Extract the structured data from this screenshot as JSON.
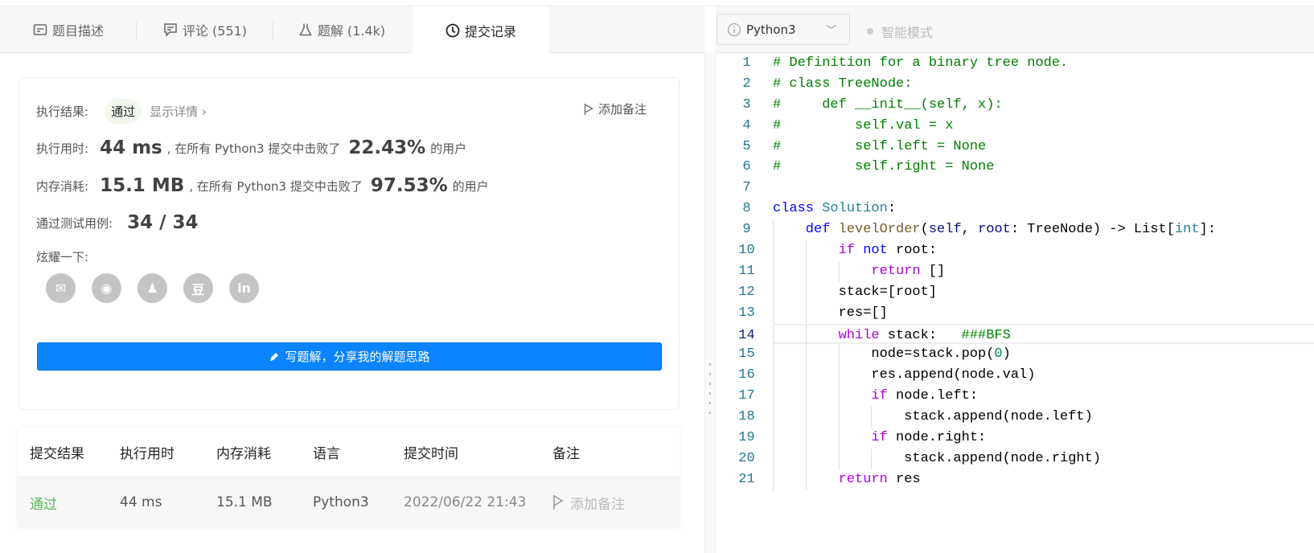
{
  "tabs": [
    {
      "label": "题目描述",
      "icon": "description-icon"
    },
    {
      "label": "评论 (551)",
      "icon": "comment-icon"
    },
    {
      "label": "题解 (1.4k)",
      "icon": "flask-icon"
    },
    {
      "label": "提交记录",
      "icon": "clock-icon"
    }
  ],
  "result": {
    "label": "执行结果:",
    "status": "通过",
    "details": "显示详情 ›",
    "add_note": "添加备注",
    "time_label": "执行用时:",
    "time_value": "44 ms",
    "time_text": ", 在所有 Python3 提交中击败了",
    "time_pct": "22.43%",
    "users": "的用户",
    "mem_label": "内存消耗:",
    "mem_value": "15.1 MB",
    "mem_text": ", 在所有 Python3 提交中击败了",
    "mem_pct": "97.53%",
    "tests_label": "通过测试用例:",
    "tests_value": "34 / 34",
    "share_label": "炫耀一下:",
    "social": [
      "wechat",
      "weibo",
      "qq",
      "douban",
      "linkedin"
    ],
    "write_button": "写题解，分享我的解题思路"
  },
  "table": {
    "headers": [
      "提交结果",
      "执行用时",
      "内存消耗",
      "语言",
      "提交时间",
      "备注"
    ],
    "rows": [
      {
        "status": "通过",
        "time": "44 ms",
        "memory": "15.1 MB",
        "language": "Python3",
        "submitted": "2022/06/22 21:43",
        "note": "添加备注"
      }
    ]
  },
  "colors": {
    "accent": "#0a84ff",
    "success": "#5cb85c"
  },
  "editor": {
    "language": "Python3",
    "smart_mode": "智能模式",
    "current_line": 14,
    "lines": [
      [
        [
          "# Definition for a binary tree node.",
          "cm"
        ]
      ],
      [
        [
          "# class TreeNode:",
          "cm"
        ]
      ],
      [
        [
          "#     def __init__(self, x):",
          "cm"
        ]
      ],
      [
        [
          "#         self.val = x",
          "cm"
        ]
      ],
      [
        [
          "#         self.left = None",
          "cm"
        ]
      ],
      [
        [
          "#         self.right = None",
          "cm"
        ]
      ],
      [],
      [
        [
          "class",
          "kw"
        ],
        [
          " ",
          "tx"
        ],
        [
          "Solution",
          "tp"
        ],
        [
          ":",
          "tx"
        ]
      ],
      [
        [
          "    ",
          "tx"
        ],
        [
          "def",
          "kw"
        ],
        [
          " ",
          "tx"
        ],
        [
          "levelOrder",
          "fn"
        ],
        [
          "(",
          "tx"
        ],
        [
          "self",
          "pm"
        ],
        [
          ", ",
          "tx"
        ],
        [
          "root",
          "pm"
        ],
        [
          ": TreeNode) -> List[",
          "tx"
        ],
        [
          "int",
          "tp"
        ],
        [
          "]:",
          "tx"
        ]
      ],
      [
        [
          "        ",
          "tx"
        ],
        [
          "if",
          "ctl"
        ],
        [
          " ",
          "tx"
        ],
        [
          "not",
          "kw"
        ],
        [
          " root:",
          "tx"
        ]
      ],
      [
        [
          "            ",
          "tx"
        ],
        [
          "return",
          "ctl"
        ],
        [
          " []",
          "tx"
        ]
      ],
      [
        [
          "        stack=[root]",
          "tx"
        ]
      ],
      [
        [
          "        res=[]",
          "tx"
        ]
      ],
      [
        [
          "        ",
          "tx"
        ],
        [
          "while",
          "ctl"
        ],
        [
          " stack:   ",
          "tx"
        ],
        [
          "###BFS",
          "cm"
        ]
      ],
      [
        [
          "            node=stack.pop(",
          "tx"
        ],
        [
          "0",
          "nm"
        ],
        [
          ")",
          "tx"
        ]
      ],
      [
        [
          "            res.append(node.val)",
          "tx"
        ]
      ],
      [
        [
          "            ",
          "tx"
        ],
        [
          "if",
          "ctl"
        ],
        [
          " node.left:",
          "tx"
        ]
      ],
      [
        [
          "                stack.append(node.left)",
          "tx"
        ]
      ],
      [
        [
          "            ",
          "tx"
        ],
        [
          "if",
          "ctl"
        ],
        [
          " node.right:",
          "tx"
        ]
      ],
      [
        [
          "                stack.append(node.right)",
          "tx"
        ]
      ],
      [
        [
          "        ",
          "tx"
        ],
        [
          "return",
          "ctl"
        ],
        [
          " res",
          "tx"
        ]
      ]
    ]
  }
}
